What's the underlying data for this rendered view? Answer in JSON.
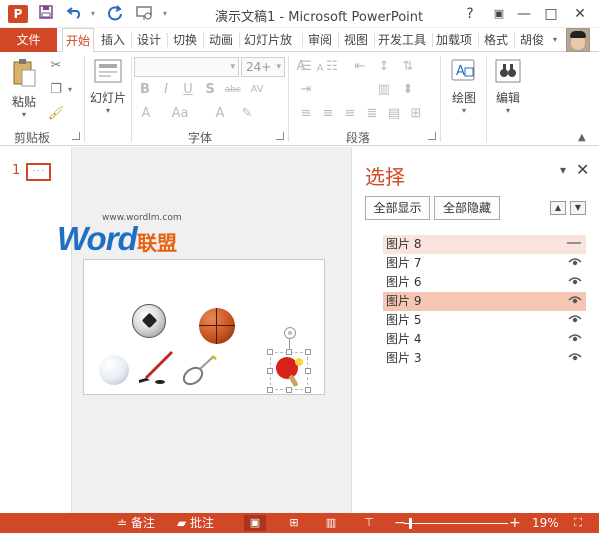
{
  "window": {
    "title": "演示文稿1 - Microsoft PowerPoint",
    "app_icon": "P",
    "help": "?",
    "minimize": "—",
    "maximize": "□",
    "close": "✕"
  },
  "qat": {
    "save_icon": "save-icon",
    "undo_icon": "undo-icon",
    "redo_icon": "redo-icon",
    "slideshow_icon": "start-slideshow-icon"
  },
  "tabs": {
    "file": "文件",
    "items": [
      "开始",
      "插入",
      "设计",
      "切换",
      "动画",
      "幻灯片放",
      "审阅",
      "视图",
      "开发工具",
      "加载项",
      "格式"
    ],
    "active": "开始",
    "user": "胡俊"
  },
  "ribbon": {
    "clipboard": {
      "label": "剪贴板",
      "paste": "粘贴"
    },
    "slides": {
      "label": "幻灯片"
    },
    "font": {
      "label": "字体",
      "font_name": "",
      "font_size": "24+"
    },
    "paragraph": {
      "label": "段落"
    },
    "drawing": {
      "label": "绘图"
    },
    "editing": {
      "label": "编辑"
    }
  },
  "thumbnails": {
    "slide_number": "1"
  },
  "watermark": {
    "url": "www.wordlm.com",
    "word": "Word",
    "cn": "联盟"
  },
  "selection_pane": {
    "title": "选择",
    "show_all": "全部显示",
    "hide_all": "全部隐藏",
    "layers": [
      {
        "name": "图片 8",
        "visible": false,
        "state": "hover"
      },
      {
        "name": "图片 7",
        "visible": true,
        "state": ""
      },
      {
        "name": "图片 6",
        "visible": true,
        "state": ""
      },
      {
        "name": "图片 9",
        "visible": true,
        "state": "selected"
      },
      {
        "name": "图片 5",
        "visible": true,
        "state": ""
      },
      {
        "name": "图片 4",
        "visible": true,
        "state": ""
      },
      {
        "name": "图片 3",
        "visible": true,
        "state": ""
      }
    ]
  },
  "statusbar": {
    "notes": "备注",
    "comments": "批注",
    "zoom": "19%",
    "zoom_minus": "−",
    "zoom_plus": "+",
    "zoom_level": 0.19
  }
}
